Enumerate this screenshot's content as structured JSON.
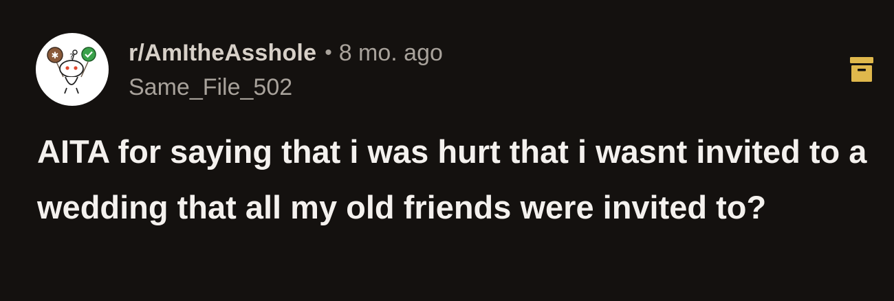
{
  "post": {
    "subreddit": "r/AmItheAsshole",
    "separator": "•",
    "age": "8 mo. ago",
    "username": "Same_File_502",
    "title": "AITA for saying that i was hurt that i wasnt invited to a wedding that all my old friends were invited to?",
    "avatar_icon": "reddit-snoo-avatar-icon",
    "archive_icon": "archive-box-icon"
  },
  "colors": {
    "background": "#14110f",
    "title_text": "#f4f1ee",
    "subreddit_text": "#d7d0c8",
    "muted_text": "#a8a29b",
    "archive_icon": "#e0b84c",
    "avatar_background": "#ffffff"
  }
}
